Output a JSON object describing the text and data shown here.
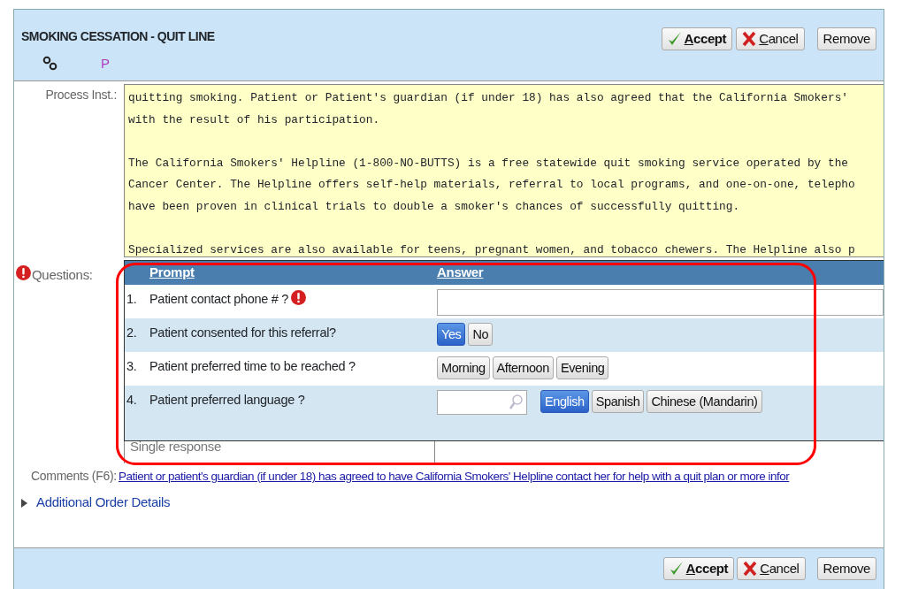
{
  "header": {
    "title": "SMOKING CESSATION - QUIT LINE",
    "status_letter": "P"
  },
  "top_buttons": [
    {
      "kind": "accept",
      "label": "Accept"
    },
    {
      "kind": "cancel",
      "label": "Cancel"
    },
    {
      "kind": "plain",
      "label": "Remove"
    }
  ],
  "process_inst": {
    "label": "Process Inst.:",
    "paragraphs": [
      [
        "quitting smoking. Patient or Patient's guardian (if under 18) has also agreed that the California Smokers'",
        "with the result of his participation."
      ],
      [
        "The California Smokers' Helpline (1-800-NO-BUTTS) is a free statewide quit smoking service operated by the",
        "Cancer Center. The Helpline offers self-help materials, referral to local programs, and one-on-one, telepho",
        "have been proven in clinical trials to double a smoker's chances of successfully quitting."
      ],
      [
        "Specialized services are also available for teens, pregnant women, and tobacco chewers. The Helpline also p"
      ]
    ]
  },
  "questions": {
    "label": "Questions:",
    "required": true,
    "columns": [
      "Prompt",
      "Answer"
    ],
    "rows": [
      {
        "number": "1.",
        "prompt": "Patient contact phone # ?",
        "required": true,
        "kind": "text"
      },
      {
        "number": "2.",
        "prompt": "Patient consented for this referral?",
        "required": false,
        "kind": "choice",
        "options": [
          {
            "label": "Yes",
            "selected": true
          },
          {
            "label": "No",
            "selected": false
          }
        ]
      },
      {
        "number": "3.",
        "prompt": "Patient preferred time to be reached ?",
        "required": false,
        "kind": "choice",
        "options": [
          {
            "label": "Morning",
            "selected": false
          },
          {
            "label": "Afternoon",
            "selected": false
          },
          {
            "label": "Evening",
            "selected": false
          }
        ]
      },
      {
        "number": "4.",
        "prompt": "Patient preferred language ?",
        "required": false,
        "kind": "search_choice",
        "options": [
          {
            "label": "English",
            "selected": true
          },
          {
            "label": "Spanish",
            "selected": false
          },
          {
            "label": "Chinese (Mandarin)",
            "selected": false
          }
        ]
      }
    ],
    "footer_text": "Single response"
  },
  "comments": {
    "label": "Comments (F6):",
    "text": "Patient or patient's guardian (if under 18) has agreed to have California Smokers' Helpline contact her for help with a quit plan or more infor"
  },
  "additional": {
    "label": "Additional Order Details",
    "expanded": false
  },
  "bottom_buttons": [
    {
      "kind": "accept",
      "label": "Accept"
    },
    {
      "kind": "cancel",
      "label": "Cancel"
    },
    {
      "kind": "plain",
      "label": "Remove"
    }
  ]
}
